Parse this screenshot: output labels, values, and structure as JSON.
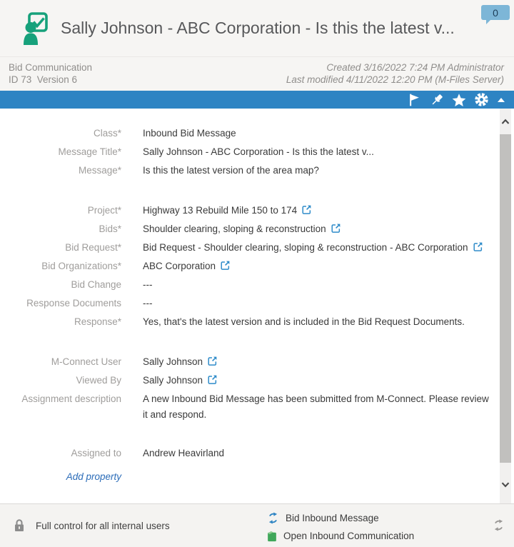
{
  "header": {
    "title": "Sally Johnson - ABC Corporation - Is this the latest v...",
    "badge_count": "0"
  },
  "subheader": {
    "object_type": "Bid Communication",
    "id_version": "ID 73  Version 6",
    "created": "Created 3/16/2022 7:24 PM Administrator",
    "last_modified": "Last modified 4/11/2022 12:20 PM (M-Files Server)"
  },
  "toolbar": {
    "icons": [
      "flag-icon",
      "pin-icon",
      "star-icon",
      "gear-icon",
      "collapse-icon"
    ]
  },
  "properties": [
    {
      "label": "Class*",
      "value": "Inbound Bid Message",
      "external": false,
      "gap": false
    },
    {
      "label": "Message Title*",
      "value": "Sally Johnson - ABC Corporation - Is this the latest v...",
      "external": false,
      "gap": false
    },
    {
      "label": "Message*",
      "value": "Is this the latest version of the area map?",
      "external": false,
      "gap": false
    },
    {
      "label": "Project*",
      "value": "Highway 13 Rebuild Mile 150 to 174",
      "external": true,
      "gap": true
    },
    {
      "label": "Bids*",
      "value": "Shoulder clearing, sloping & reconstruction",
      "external": true,
      "gap": false
    },
    {
      "label": "Bid Request*",
      "value": "Bid Request - Shoulder clearing, sloping & reconstruction - ABC Corporation",
      "external": true,
      "gap": false
    },
    {
      "label": "Bid Organizations*",
      "value": "ABC Corporation",
      "external": true,
      "gap": false
    },
    {
      "label": "Bid Change",
      "value": "---",
      "external": false,
      "gap": false
    },
    {
      "label": "Response Documents",
      "value": "---",
      "external": false,
      "gap": false
    },
    {
      "label": "Response*",
      "value": "Yes, that's the latest version and is included in the Bid Request Documents.",
      "external": false,
      "gap": false
    },
    {
      "label": "M-Connect User",
      "value": "Sally Johnson",
      "external": true,
      "gap": true
    },
    {
      "label": "Viewed By",
      "value": "Sally Johnson",
      "external": true,
      "gap": false
    },
    {
      "label": "Assignment description",
      "value": "A new Inbound Bid Message has been submitted from M-Connect. Please review it and respond.",
      "external": false,
      "gap": false
    },
    {
      "label": "Assigned to",
      "value": "Andrew Heavirland",
      "external": false,
      "gap": true
    }
  ],
  "add_property_label": "Add property",
  "footer": {
    "permissions": "Full control for all internal users",
    "workflow": "Bid Inbound Message",
    "state": "Open Inbound Communication"
  },
  "icons": {
    "assignment-icon": "person-with-checked-document",
    "comments-badge": "speech-bubble",
    "flag-icon": "flag",
    "pin-icon": "pushpin",
    "star-icon": "star",
    "gear-icon": "gear",
    "collapse-icon": "triangle-up",
    "external-link-icon": "open-in-new-window",
    "lock-icon": "padlock",
    "workflow-icon": "circular-arrows",
    "state-icon": "green-document",
    "refresh-icon": "circular-arrows"
  },
  "colors": {
    "accent_blue": "#2e84c3",
    "assignment_green": "#17a17b",
    "link_blue": "#2d8bc9",
    "state_green": "#3fa75a",
    "badge_blue": "#7db6d7",
    "header_bg": "#f6f5f3",
    "label_gray": "#9f9d9b"
  }
}
